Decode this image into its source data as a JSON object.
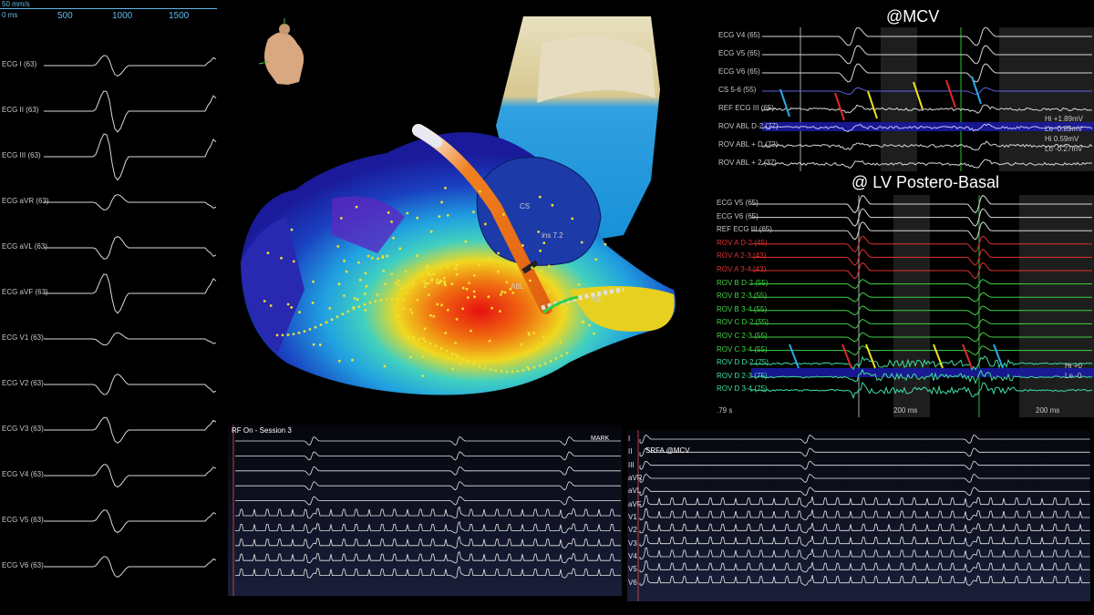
{
  "ecg12": {
    "scale": "50 mm/s",
    "ms_label": "0 ms",
    "ticks": [
      "500",
      "1000",
      "1500"
    ],
    "leads": [
      "ECG I (63)",
      "ECG II (63)",
      "ECG III (63)",
      "ECG aVR (63)",
      "ECG aVL (63)",
      "ECG aVF (63)",
      "ECG V1 (63)",
      "ECG V2 (63)",
      "ECG V3 (63)",
      "ECG V4 (63)",
      "ECG V5 (63)",
      "ECG V6 (63)"
    ]
  },
  "map3d": {
    "labels": [
      "CS",
      "ins 7.2",
      "ABL",
      "ABL"
    ]
  },
  "mcv": {
    "title": "@MCV",
    "channels": [
      "ECG V4 (65)",
      "ECG V5 (65)",
      "ECG V6 (65)",
      "CS 5-6 (55)",
      "REF ECG III (65)",
      "ROV ABL D-2 (77)",
      "ROV ABL + D (72)",
      "ROV ABL + 2 (37)"
    ],
    "readouts": [
      "Hi +1.89mV",
      "Lo -0.89mV",
      "Hi 0.59mV",
      "Lo -0.27mV"
    ]
  },
  "lvpb": {
    "title": "@ LV Postero-Basal",
    "channels": [
      "ECG V5 (65)",
      "ECG V6 (65)",
      "REF ECG III (65)",
      "ROV A  D-2 (45)",
      "ROV A  2-3 (43)",
      "ROV A  3-4 (43)",
      "ROV B  D-2 (55)",
      "ROV B  2-3 (55)",
      "ROV B  3-4 (55)",
      "ROV C  D-2 (55)",
      "ROV C  2-3 (55)",
      "ROV C  3-4 (55)",
      "ROV D  D-2 (75)",
      "ROV D  2-3 (75)",
      "ROV D  3-4 (75)"
    ],
    "time": ".79 s",
    "scale1": "200 ms",
    "scale2": "200 ms",
    "readouts": [
      "Hi +0",
      "Lo -0"
    ]
  },
  "rfon": {
    "title": "RF On - Session 3",
    "mark": "MARK"
  },
  "srfa": {
    "title": "SRFA @MCV",
    "leads": [
      "I",
      "II",
      "III",
      "aVR",
      "aVL",
      "aVF",
      "V1",
      "V2",
      "V3",
      "V4",
      "V5",
      "V6"
    ]
  },
  "colors": {
    "blue_arrow": "#29a8e8",
    "red_arrow": "#e02a2a",
    "yellow_arrow": "#f0e020",
    "green_trace": "#3fd43f",
    "red_trace": "#e03030",
    "blue_band": "#1a1aa0"
  }
}
